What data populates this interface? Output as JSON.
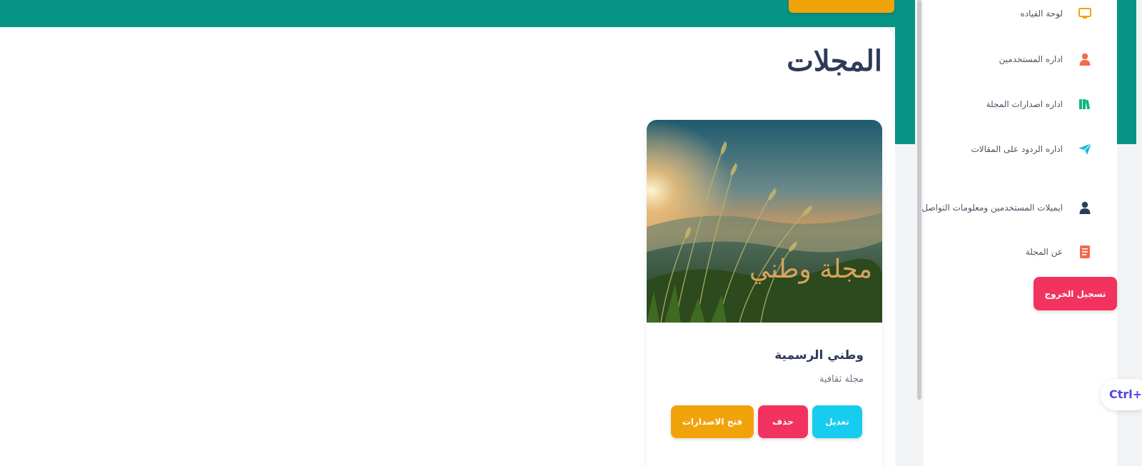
{
  "header": {
    "top_button_label": ""
  },
  "main": {
    "page_title": "المجلات",
    "card": {
      "image_caption": "مجلة وطني",
      "title": "وطني الرسمية",
      "subtitle": "مجلة ثقافية",
      "actions": {
        "open_issues": "فتح الاصدارات",
        "delete": "حذف",
        "edit": "تعديل"
      }
    }
  },
  "sidebar": {
    "items": [
      {
        "label": "لوحة القياده",
        "icon": "monitor-icon",
        "color": "#f1a30a"
      },
      {
        "label": "اداره المستخدمين",
        "icon": "user-icon",
        "color": "#f26b4a"
      },
      {
        "label": "اداره اصدارات المجلة",
        "icon": "books-icon",
        "color": "#10b981"
      },
      {
        "label": "اداره الردود على المقالات",
        "icon": "paper-plane-icon",
        "color": "#1cb5e0"
      },
      {
        "label": "ايميلات المستخدمين ومعلومات التواصل",
        "icon": "person-icon",
        "color": "#2e3a59"
      },
      {
        "label": "عن المجلة",
        "icon": "document-icon",
        "color": "#f26b4a"
      }
    ],
    "logout_label": "تسجيل الخروج"
  },
  "shortcut_hint": "Ctrl+",
  "colors": {
    "teal": "#069485",
    "amber": "#f1a30a",
    "rose": "#f2325f",
    "cyan": "#16cdef",
    "navy": "#2e3a59"
  }
}
